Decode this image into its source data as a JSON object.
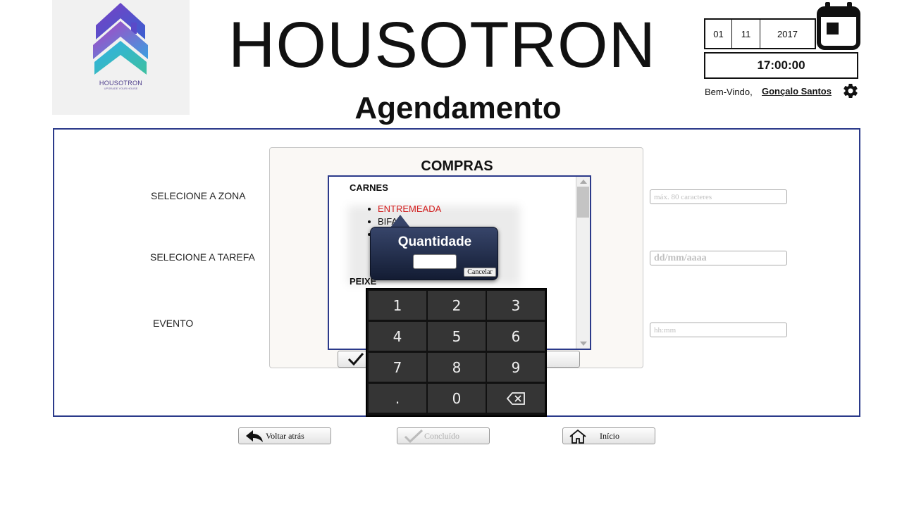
{
  "logo": {
    "name": "HOUSOTRON",
    "tagline": "UPGRADE YOUR HOUSE"
  },
  "app_title": "HOUSOTRON",
  "page_title": "Agendamento",
  "header": {
    "date": {
      "day": "01",
      "month": "11",
      "year": "2017"
    },
    "time": "17:00:00",
    "welcome": "Bem-Vindo,",
    "user": "Gonçalo Santos"
  },
  "form": {
    "zone_label": "SELECIONE A ZONA",
    "task_label": "SELECIONE A TAREFA",
    "event_label": "EVENTO",
    "text_placeholder": "máx. 80 caracteres",
    "date_placeholder": "dd/mm/aaaa",
    "time_placeholder": "hh:mm"
  },
  "shopping": {
    "title": "COMPRAS",
    "categories": [
      {
        "name": "CARNES",
        "items": [
          "ENTREMEADA",
          "BIFA",
          ""
        ]
      },
      {
        "name": "PEIXE",
        "items": []
      }
    ],
    "selected_item": "ENTREMEADA"
  },
  "quantity_popup": {
    "title": "Quantidade",
    "value": "",
    "cancel_label": "Cancelar"
  },
  "numpad": {
    "keys": [
      "1",
      "2",
      "3",
      "4",
      "5",
      "6",
      "7",
      "8",
      "9",
      ".",
      "0",
      "⌫"
    ]
  },
  "footer": {
    "back_label": "Voltar atrás",
    "done_label": "Concluído",
    "home_label": "Início"
  },
  "colors": {
    "panel_border": "#2b3a8a",
    "selected_item": "#e02020",
    "popup_bg": "#1e2a48"
  }
}
